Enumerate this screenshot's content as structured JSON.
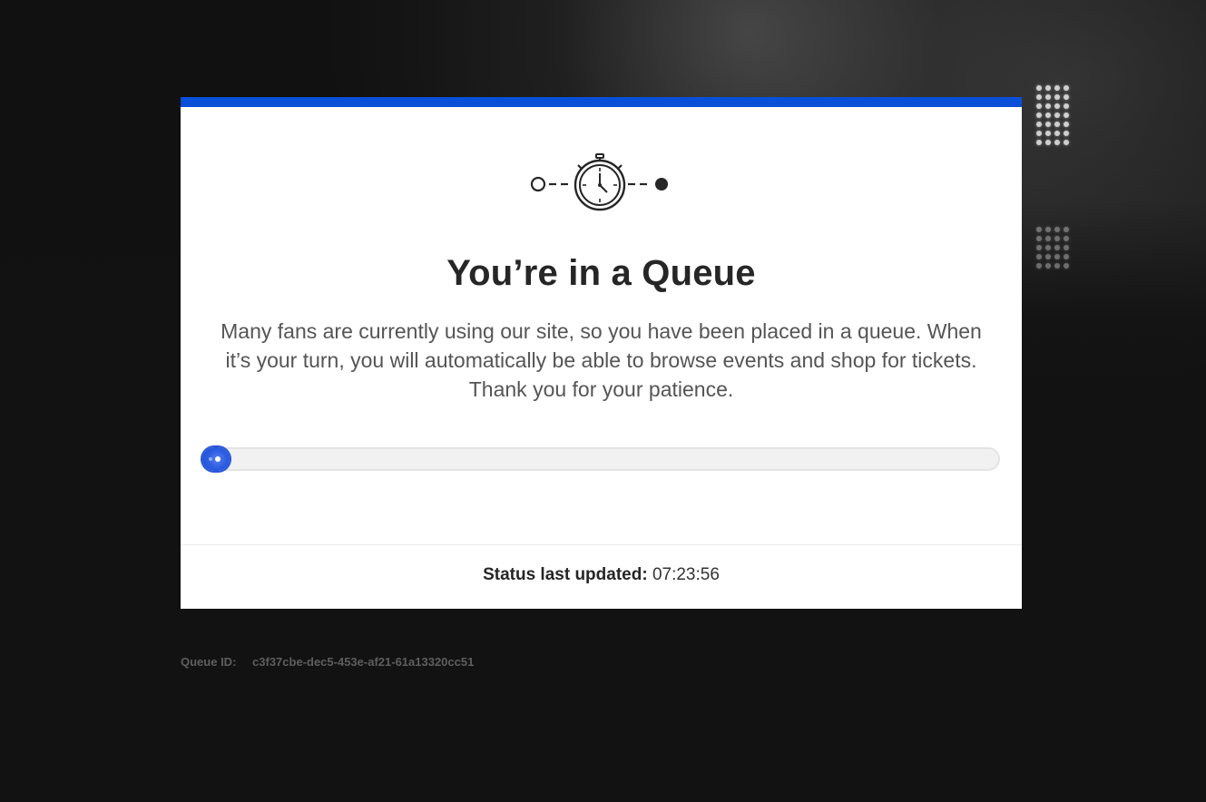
{
  "page": {
    "accent_color": "#0a4fd8",
    "background_color": "#121212"
  },
  "hero": {
    "icon": "stopwatch-progress-icon"
  },
  "card": {
    "title": "You’re in a Queue",
    "description": "Many fans are currently using our site, so you have been placed in a queue. When it’s your turn, you will automatically be able to browse events and shop for tickets. Thank you for your patience."
  },
  "progress": {
    "percent": 2
  },
  "status": {
    "label": "Status last updated:",
    "time": "07:23:56"
  },
  "queue": {
    "label": "Queue ID:",
    "id": "c3f37cbe-dec5-453e-af21-61a13320cc51"
  }
}
